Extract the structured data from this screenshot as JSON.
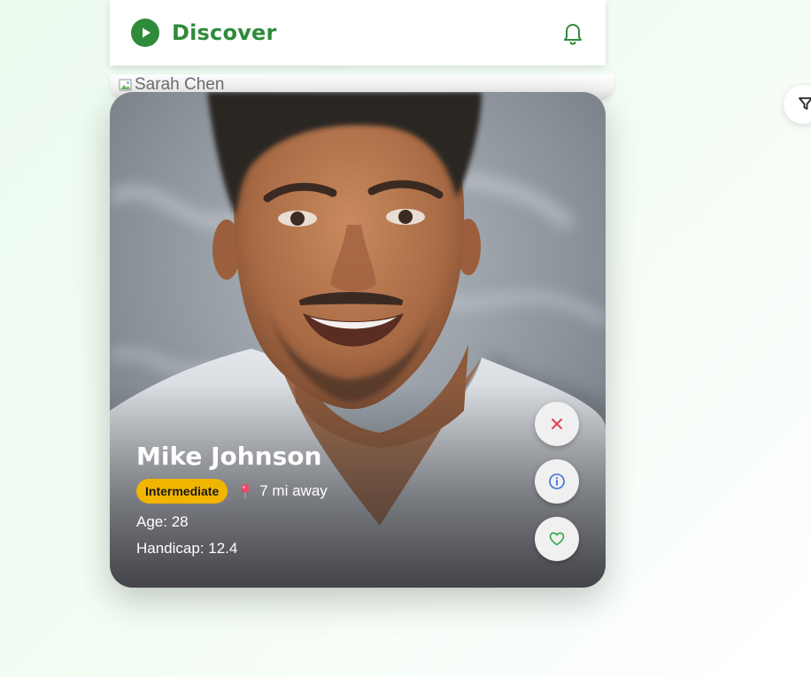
{
  "header": {
    "title": "Discover",
    "brand_color": "#2e8b3a",
    "logo_icon": "play-circle-icon",
    "notification_icon": "bell-icon"
  },
  "back_card": {
    "image_alt": "Sarah Chen",
    "image_icon": "broken-image-icon"
  },
  "filter": {
    "icon": "filter-icon"
  },
  "profile": {
    "name": "Mike Johnson",
    "skill_level": "Intermediate",
    "skill_badge_color": "#f1b500",
    "distance": "7 mi away",
    "age": "Age: 28",
    "handicap": "Handicap: 12.4"
  },
  "actions": [
    {
      "name": "pass-button",
      "icon": "close-icon",
      "color": "#e0434b"
    },
    {
      "name": "info-button",
      "icon": "info-icon",
      "color": "#3a6fd8"
    },
    {
      "name": "like-button",
      "icon": "heart-icon",
      "color": "#2ea84a"
    }
  ]
}
